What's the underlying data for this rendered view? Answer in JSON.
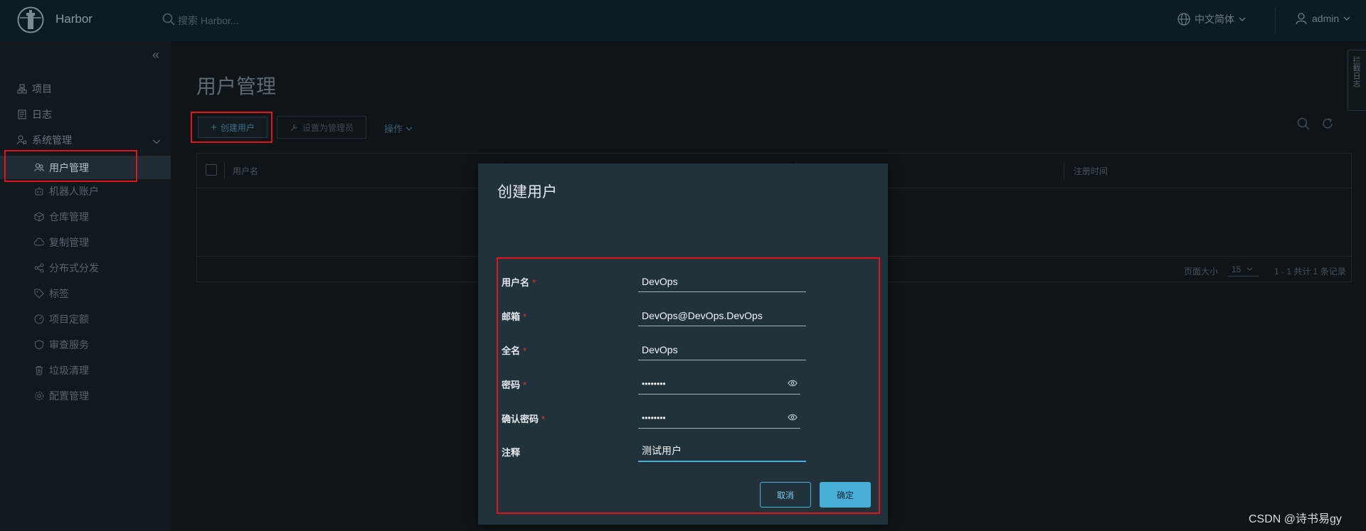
{
  "header": {
    "brand": "Harbor",
    "search_placeholder": "搜索 Harbor...",
    "language": "中文简体",
    "user": "admin"
  },
  "sidebar": {
    "items": [
      {
        "label": "项目",
        "icon": "projects-icon"
      },
      {
        "label": "日志",
        "icon": "logs-icon"
      },
      {
        "label": "系统管理",
        "icon": "admin-icon",
        "expanded": true
      }
    ],
    "admin_items": [
      {
        "label": "用户管理",
        "icon": "users-icon",
        "active": true
      },
      {
        "label": "机器人账户",
        "icon": "robot-icon"
      },
      {
        "label": "仓库管理",
        "icon": "registry-icon"
      },
      {
        "label": "复制管理",
        "icon": "replication-icon"
      },
      {
        "label": "分布式分发",
        "icon": "distribution-icon"
      },
      {
        "label": "标签",
        "icon": "tag-icon"
      },
      {
        "label": "项目定额",
        "icon": "quota-icon"
      },
      {
        "label": "审查服务",
        "icon": "shield-icon"
      },
      {
        "label": "垃圾清理",
        "icon": "trash-icon"
      },
      {
        "label": "配置管理",
        "icon": "gear-icon"
      }
    ]
  },
  "main": {
    "title": "用户管理",
    "toolbar": {
      "create": "创建用户",
      "set_admin": "设置为管理员",
      "actions": "操作"
    },
    "columns": [
      "用户名",
      "注册时间"
    ],
    "footer": {
      "page_size_label": "页面大小",
      "page_size": "15",
      "summary": "1 - 1 共计 1 条记录"
    },
    "side_panel": "拦截日志"
  },
  "modal": {
    "title": "创建用户",
    "fields": {
      "username": {
        "label": "用户名",
        "value": "DevOps"
      },
      "email": {
        "label": "邮箱",
        "value": "DevOps@DevOps.DevOps"
      },
      "fullname": {
        "label": "全名",
        "value": "DevOps"
      },
      "password": {
        "label": "密码",
        "value": "••••••••"
      },
      "confirm": {
        "label": "确认密码",
        "value": "••••••••"
      },
      "comment": {
        "label": "注释",
        "value": "测试用户"
      }
    },
    "required_mark": "*",
    "cancel": "取消",
    "ok": "确定"
  },
  "watermark": "CSDN @诗书易gy",
  "colors": {
    "accent": "#49afd9",
    "header_bg": "#0b1c24",
    "modal_bg": "#21323a",
    "highlight": "#e4121f",
    "required": "#e1363c"
  }
}
